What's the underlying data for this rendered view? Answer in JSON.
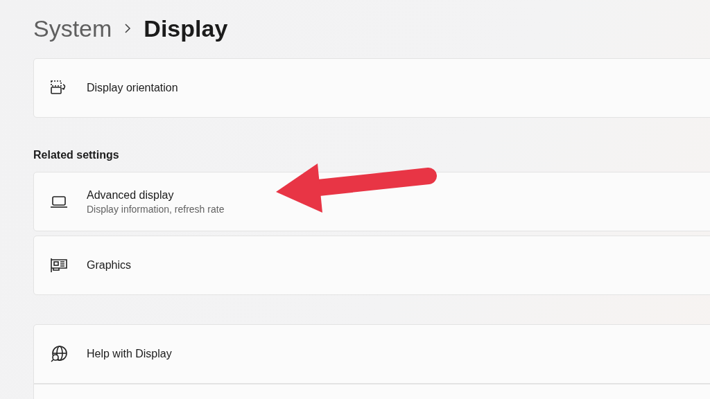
{
  "breadcrumb": [
    {
      "label": "System",
      "selected": false
    },
    {
      "label": "Display",
      "selected": true
    }
  ],
  "groups": [
    {
      "cards": [
        {
          "kind": "orientation",
          "title": "Display orientation"
        }
      ]
    },
    {
      "heading": "Related settings",
      "cards": [
        {
          "kind": "laptop",
          "title": "Advanced display",
          "subtitle": "Display information, refresh rate"
        },
        {
          "kind": "graphics",
          "title": "Graphics"
        }
      ]
    },
    {
      "cards": [
        {
          "kind": "help",
          "title": "Help with Display"
        },
        {
          "kind": "blank"
        }
      ]
    }
  ]
}
